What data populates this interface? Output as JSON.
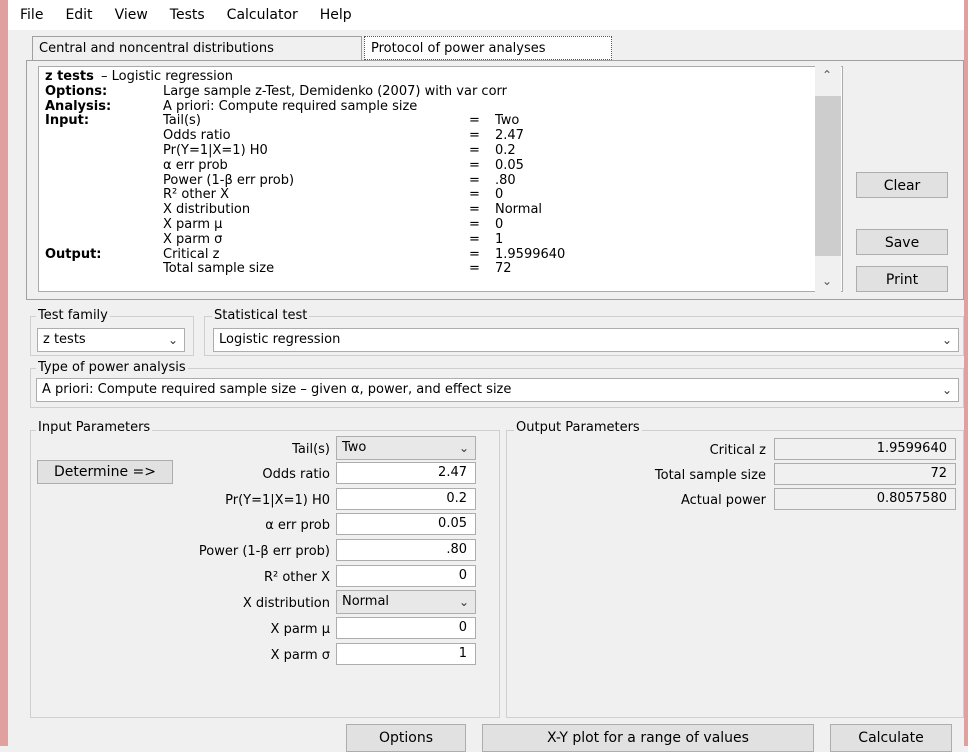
{
  "menu": [
    "File",
    "Edit",
    "View",
    "Tests",
    "Calculator",
    "Help"
  ],
  "tabs": {
    "distributions": "Central and noncentral distributions",
    "protocol": "Protocol of power analyses"
  },
  "protocol": {
    "title_bold": "z tests",
    "title_rest": " – Logistic regression",
    "options_key": "Options:",
    "options_val": "Large sample z-Test, Demidenko (2007) with var corr",
    "analysis_key": "Analysis:",
    "analysis_val": "A priori: Compute required sample size",
    "input_key": "Input:",
    "output_key": "Output:",
    "eq": "=",
    "inputs": [
      {
        "label": "Tail(s)",
        "value": "Two"
      },
      {
        "label": "Odds ratio",
        "value": "2.47"
      },
      {
        "label": "Pr(Y=1|X=1) H0",
        "value": "0.2"
      },
      {
        "label": "α err prob",
        "value": "0.05"
      },
      {
        "label": "Power (1-β err prob)",
        "value": ".80"
      },
      {
        "label": "R² other X",
        "value": "0"
      },
      {
        "label": "X distribution",
        "value": "Normal"
      },
      {
        "label": "X parm μ",
        "value": "0"
      },
      {
        "label": "X parm σ",
        "value": "1"
      }
    ],
    "outputs": [
      {
        "label": "Critical z",
        "value": "1.9599640"
      },
      {
        "label": "Total sample size",
        "value": "72"
      }
    ]
  },
  "side_buttons": {
    "clear": "Clear",
    "save": "Save",
    "print": "Print"
  },
  "test_family": {
    "label": "Test family",
    "value": "z tests"
  },
  "statistical_test": {
    "label": "Statistical test",
    "value": "Logistic regression"
  },
  "power_analysis": {
    "label": "Type of power analysis",
    "value": "A priori: Compute required sample size – given α, power, and effect size"
  },
  "input_params": {
    "title": "Input Parameters",
    "determine": "Determine =>",
    "tails_label": "Tail(s)",
    "tails_value": "Two",
    "odds_label": "Odds ratio",
    "odds_value": "2.47",
    "pr_label": "Pr(Y=1|X=1) H0",
    "pr_value": "0.2",
    "alpha_label": "α err prob",
    "alpha_value": "0.05",
    "power_label": "Power (1-β err prob)",
    "power_value": ".80",
    "r2_label": "R² other X",
    "r2_value": "0",
    "xdist_label": "X distribution",
    "xdist_value": "Normal",
    "mu_label": "X parm μ",
    "mu_value": "0",
    "sigma_label": "X parm σ",
    "sigma_value": "1"
  },
  "output_params": {
    "title": "Output Parameters",
    "critz_label": "Critical z",
    "critz_value": "1.9599640",
    "n_label": "Total sample size",
    "n_value": "72",
    "power_label": "Actual power",
    "power_value": "0.8057580"
  },
  "bottom": {
    "options": "Options",
    "xy": "X-Y plot for a range of values",
    "calculate": "Calculate"
  }
}
